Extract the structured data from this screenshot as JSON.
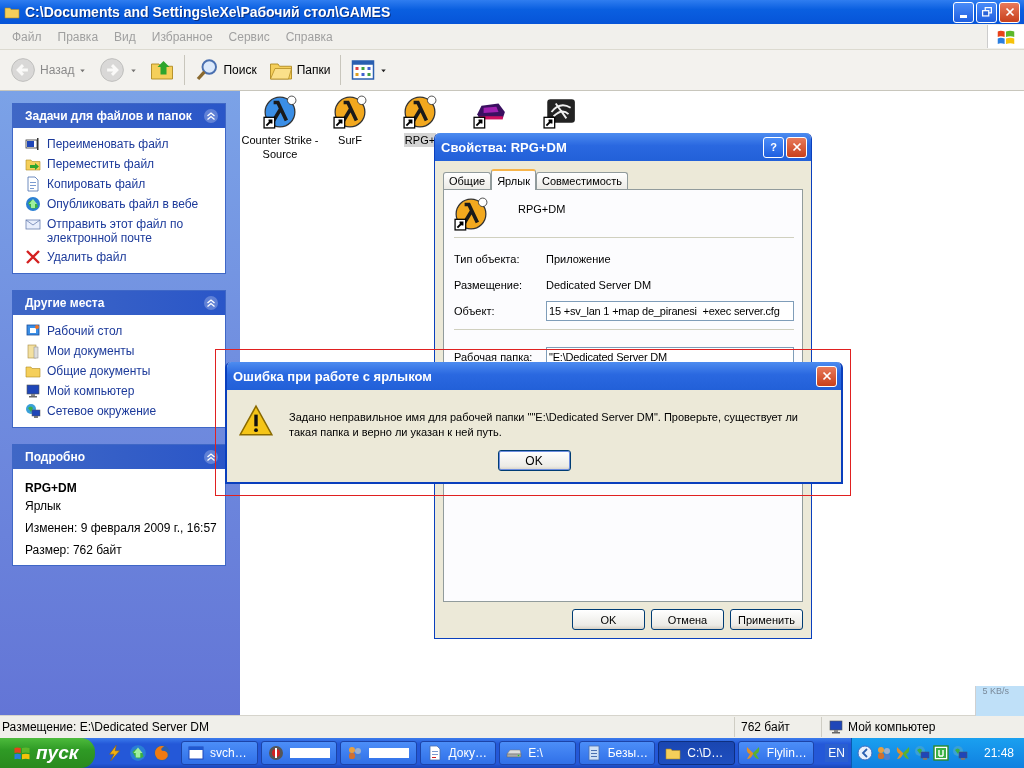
{
  "window": {
    "title": "C:\\Documents and Settings\\eXe\\Рабочий стол\\GAMES"
  },
  "menu": [
    {
      "label": "Файл",
      "disabled": true
    },
    {
      "label": "Правка",
      "disabled": true
    },
    {
      "label": "Вид",
      "disabled": true
    },
    {
      "label": "Избранное",
      "disabled": true
    },
    {
      "label": "Сервис",
      "disabled": true
    },
    {
      "label": "Справка",
      "disabled": true
    }
  ],
  "toolbar": [
    {
      "label": "Назад",
      "disabled": true
    },
    {
      "disabled": true
    },
    {
      "disabled": false
    },
    {
      "label": "Поиск",
      "disabled": false
    },
    {
      "label": "Папки",
      "disabled": false
    },
    {
      "disabled": false
    }
  ],
  "sidebar": [
    {
      "title": "Задачи для файлов и папок",
      "items": [
        "Переименовать файл",
        "Переместить файл",
        "Копировать файл",
        "Опубликовать файл в вебе",
        "Отправить этот файл по электронной почте",
        "Удалить файл"
      ]
    },
    {
      "title": "Другие места",
      "items": [
        "Рабочий стол",
        "Мои документы",
        "Общие документы",
        "Мой компьютер",
        "Сетевое окружение"
      ]
    },
    {
      "title": "Подробно",
      "details": {
        "name": "RPG+DM",
        "type": "Ярлык",
        "lines": [
          "Изменен: 9 февраля 2009 г., 16:57",
          "Размер: 762 байт"
        ]
      }
    }
  ],
  "files": [
    {
      "name": "Counter Strike - Source",
      "selected": false
    },
    {
      "name": "SurF",
      "selected": false
    },
    {
      "name": "RPG+",
      "selected": true
    }
  ],
  "properties": {
    "title": "Свойства: RPG+DM",
    "help_button": "?",
    "tabs": [
      {
        "label": "Общие",
        "selected": false
      },
      {
        "label": "Ярлык",
        "selected": true
      },
      {
        "label": "Совместимость",
        "selected": false
      }
    ],
    "name": "RPG+DM",
    "rows": [
      {
        "kind": "text",
        "label": "Тип объекта:",
        "value": "Приложение"
      },
      {
        "kind": "text",
        "label": "Размещение:",
        "value": "Dedicated Server DM"
      },
      {
        "kind": "input",
        "label": "Объект:",
        "value": "15 +sv_lan 1 +map de_piranesi  +exec server.cfg"
      },
      {
        "kind": "input",
        "label": "Рабочая папка:",
        "value": "\"E:\\Dedicated Server DM"
      }
    ],
    "buttons": [
      "OK",
      "Отмена",
      "Применить"
    ]
  },
  "error_dialog": {
    "title": "Ошибка при работе с ярлыком",
    "message": "Задано неправильное имя для рабочей папки \"\"E:\\Dedicated Server DM\". Проверьте, существует ли такая папка и верно ли указан к ней путь.",
    "button": "OK"
  },
  "status_bar": [
    "Размещение: E:\\Dedicated Server DM",
    "762 байт",
    "Мой компьютер"
  ],
  "net_meter": {
    "reading": "5 KB/s"
  },
  "taskbar": {
    "start": "пуск",
    "tasks": [
      {
        "label": "svch…",
        "active": false,
        "redacted": false
      },
      {
        "active": false,
        "redacted": true
      },
      {
        "active": false,
        "redacted": true
      },
      {
        "label": "Доку…",
        "active": false,
        "redacted": false
      },
      {
        "label": "E:\\",
        "active": false,
        "redacted": false
      },
      {
        "label": "Безы…",
        "active": false,
        "redacted": false
      },
      {
        "label": "C:\\D…",
        "active": true,
        "redacted": false
      },
      {
        "label": "Flylin…",
        "active": false,
        "redacted": false
      }
    ],
    "language": "EN",
    "clock": "21:48"
  }
}
